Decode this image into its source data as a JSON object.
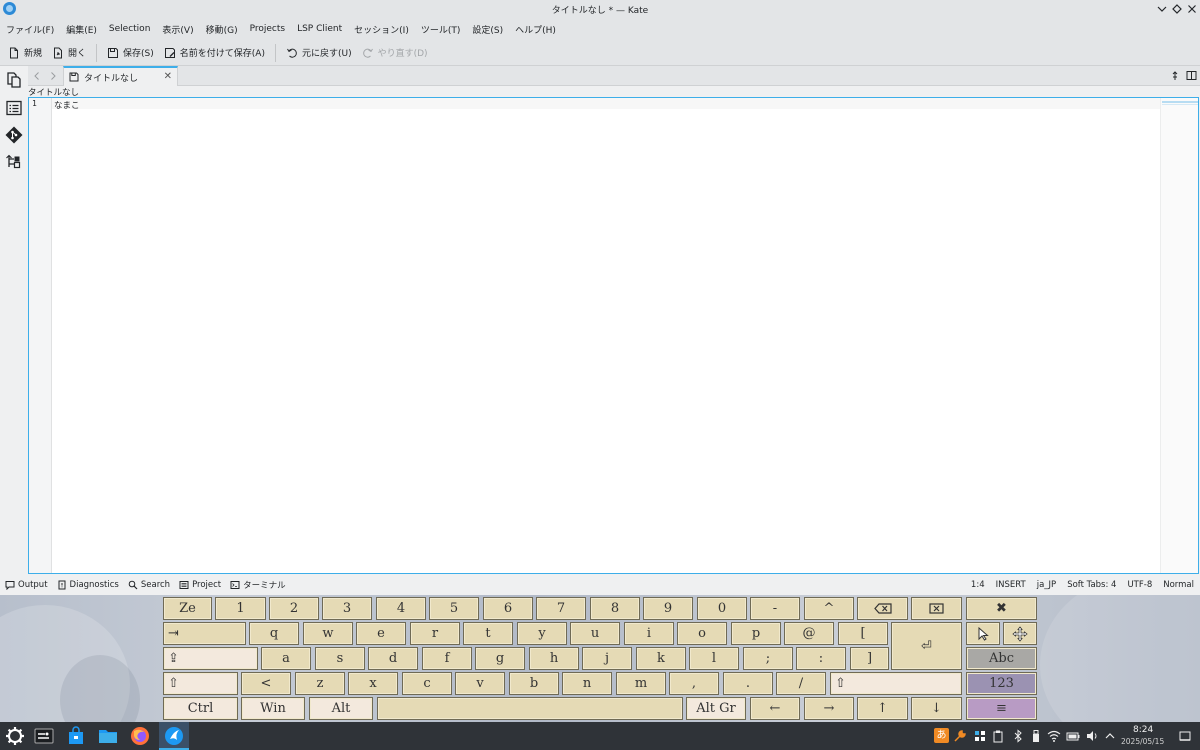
{
  "window": {
    "title": "タイトルなし * — Kate"
  },
  "menu": [
    "ファイル(F)",
    "編集(E)",
    "Selection",
    "表示(V)",
    "移動(G)",
    "Projects",
    "LSP Client",
    "セッション(I)",
    "ツール(T)",
    "設定(S)",
    "ヘルプ(H)"
  ],
  "toolbar": {
    "new": "新規",
    "open": "開く",
    "save": "保存(S)",
    "save_as": "名前を付けて保存(A)",
    "undo": "元に戻す(U)",
    "redo": "やり直す(D)"
  },
  "tab": {
    "label": "タイトルなし"
  },
  "breadcrumb": "タイトルなし",
  "editor": {
    "line_number": "1",
    "text": "なまこ"
  },
  "bottom_tools": [
    "Output",
    "Diagnostics",
    "Search",
    "Project",
    "ターミナル"
  ],
  "status": {
    "cursor": "1:4",
    "mode": "INSERT",
    "language": "ja_JP",
    "indent": "Soft Tabs: 4",
    "encoding": "UTF-8",
    "input_mode": "Normal"
  },
  "keyboard": {
    "row1": [
      "Ze",
      "1",
      "2",
      "3",
      "4",
      "5",
      "6",
      "7",
      "8",
      "9",
      "0",
      "-",
      "^"
    ],
    "row2": [
      "q",
      "w",
      "e",
      "r",
      "t",
      "y",
      "u",
      "i",
      "o",
      "p",
      "@",
      "["
    ],
    "row3": [
      "a",
      "s",
      "d",
      "f",
      "g",
      "h",
      "j",
      "k",
      "l",
      ";",
      ":",
      "]"
    ],
    "row4": [
      "<",
      "z",
      "x",
      "c",
      "v",
      "b",
      "n",
      "m",
      ",",
      ".",
      "/"
    ],
    "row5": {
      "ctrl": "Ctrl",
      "win": "Win",
      "alt": "Alt",
      "altgr": "Alt Gr",
      "left": "←",
      "right": "→",
      "up": "↑",
      "down": "↓"
    },
    "side": {
      "abc": "Abc",
      "num": "123",
      "menu": "≡",
      "close": "✖"
    },
    "symbols": {
      "tab": "⇥",
      "shift": "⇧",
      "caps": "⇪",
      "enter": "⏎"
    }
  },
  "clock": {
    "time": "8:24",
    "date": "2025/05/15"
  },
  "tray": {
    "ime": "あ"
  },
  "colors": {
    "accent": "#3daee9",
    "key": "#e5dab5",
    "taskbar": "#2f3338"
  }
}
